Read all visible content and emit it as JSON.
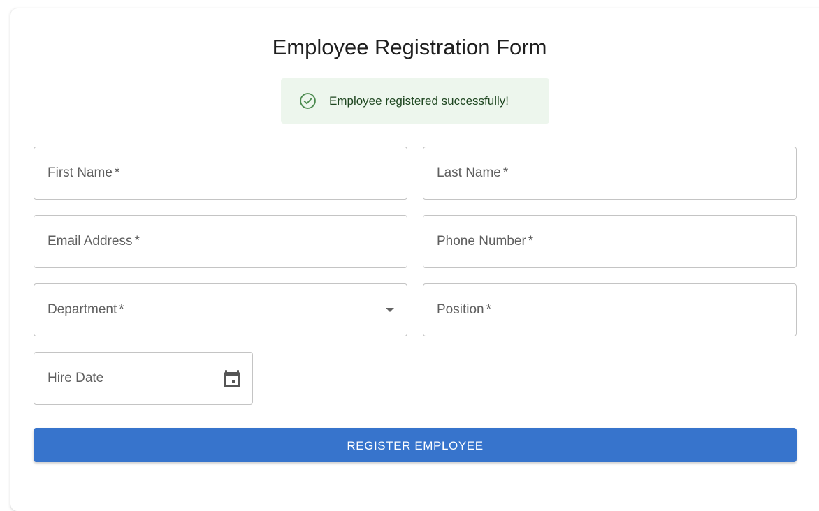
{
  "form": {
    "title": "Employee Registration Form",
    "alert": {
      "message": "Employee registered successfully!",
      "icon": "check-circle-icon",
      "color": "#1e4620",
      "background": "#edf6ed"
    },
    "fields": {
      "first_name": {
        "label": "First Name",
        "required_mark": "*",
        "value": ""
      },
      "last_name": {
        "label": "Last Name",
        "required_mark": "*",
        "value": ""
      },
      "email": {
        "label": "Email Address",
        "required_mark": "*",
        "value": ""
      },
      "phone": {
        "label": "Phone Number",
        "required_mark": "*",
        "value": ""
      },
      "department": {
        "label": "Department",
        "required_mark": "*",
        "value": "",
        "icon": "chevron-down-icon"
      },
      "position": {
        "label": "Position",
        "required_mark": "*",
        "value": ""
      },
      "hire_date": {
        "label": "Hire Date",
        "value": "",
        "icon": "calendar-icon"
      }
    },
    "submit_label": "REGISTER EMPLOYEE",
    "accent_color": "#3774cc"
  }
}
